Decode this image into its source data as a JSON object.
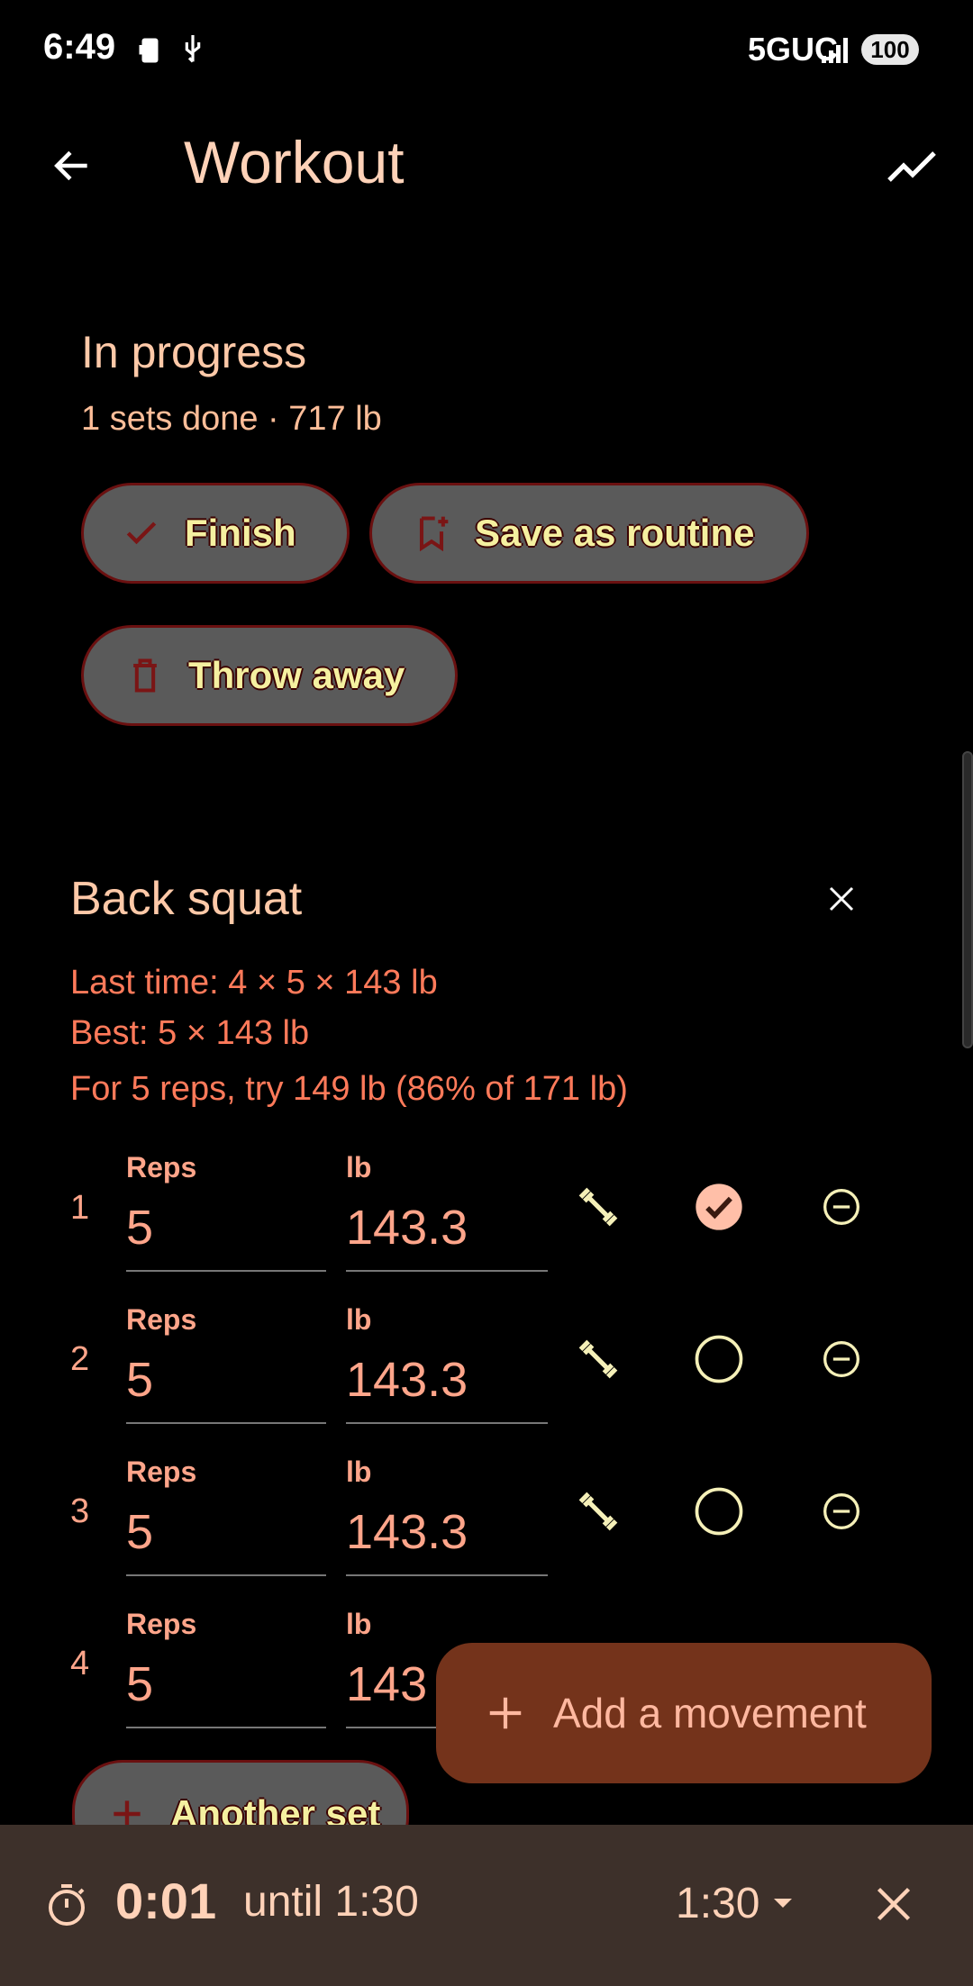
{
  "status_bar": {
    "time": "6:49",
    "network": "5GUC",
    "battery": "100"
  },
  "app_bar": {
    "title": "Workout"
  },
  "summary": {
    "heading": "In progress",
    "subtitle": "1 sets done · 717 lb"
  },
  "actions": {
    "finish": "Finish",
    "save_routine": "Save as routine",
    "throw_away": "Throw away"
  },
  "movement": {
    "name": "Back squat",
    "last_time": "Last time: 4 × 5 × 143 lb",
    "best": "Best: 5 × 143 lb",
    "suggestion": "For 5 reps, try 149 lb (86% of 171 lb)",
    "reps_label": "Reps",
    "weight_label": "lb",
    "sets": [
      {
        "num": "1",
        "reps": "5",
        "weight": "143.3",
        "done": true
      },
      {
        "num": "2",
        "reps": "5",
        "weight": "143.3",
        "done": false
      },
      {
        "num": "3",
        "reps": "5",
        "weight": "143.3",
        "done": false
      },
      {
        "num": "4",
        "reps": "5",
        "weight": "143",
        "done": false
      }
    ],
    "another_set": "Another set"
  },
  "fab": {
    "label": "Add a movement"
  },
  "timer": {
    "elapsed": "0:01",
    "until": "until 1:30",
    "duration": "1:30"
  },
  "colors": {
    "accent": "#ffa58a",
    "fab_bg": "#74331b",
    "timer_bg": "#3d302a",
    "check_fill": "#ffbfa8"
  }
}
